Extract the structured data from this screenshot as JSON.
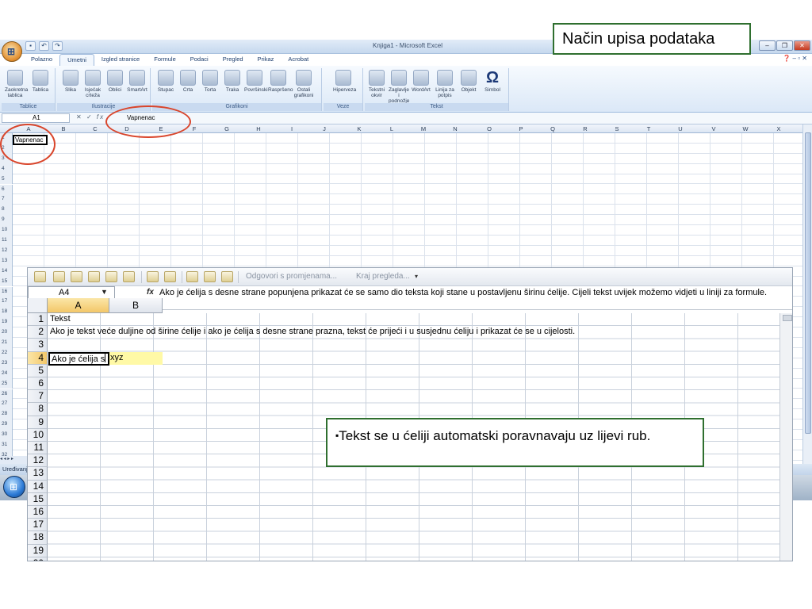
{
  "annotation": {
    "title": "Način upisa podataka",
    "note": "Tekst se u ćeliji automatski poravnavaju uz lijevi rub."
  },
  "excel2007": {
    "window_title": "Knjiga1 - Microsoft Excel",
    "tabs": [
      "Polazno",
      "Umetni",
      "Izgled stranice",
      "Formule",
      "Podaci",
      "Pregled",
      "Prikaz",
      "Acrobat"
    ],
    "active_tab": "Umetni",
    "ribbon_groups": [
      {
        "label": "Tablice",
        "buttons": [
          "Zaokretna tablica",
          "Tablica"
        ]
      },
      {
        "label": "Ilustracije",
        "buttons": [
          "Slika",
          "Isječak crteža",
          "Oblici",
          "SmartArt"
        ]
      },
      {
        "label": "Grafikoni",
        "buttons": [
          "Stupac",
          "Crta",
          "Torta",
          "Traka",
          "Površinski",
          "Raspršeno",
          "Ostali grafikoni"
        ]
      },
      {
        "label": "Veze",
        "buttons": [
          "Hiperveza"
        ]
      },
      {
        "label": "Tekst",
        "buttons": [
          "Tekstni okvir",
          "Zaglavlje i podnožje",
          "WordArt",
          "Linija za potpis",
          "Objekt",
          "Simbol"
        ]
      }
    ],
    "name_box": "A1",
    "formula_value": "Vapnenac",
    "columns": [
      "A",
      "B",
      "C",
      "D",
      "E",
      "F",
      "G",
      "H",
      "I",
      "J",
      "K",
      "L",
      "M",
      "N",
      "O",
      "P",
      "Q",
      "R",
      "S",
      "T",
      "U",
      "V",
      "W",
      "X"
    ],
    "rows": [
      "1",
      "2",
      "3",
      "4",
      "5",
      "6",
      "7",
      "8",
      "9",
      "10",
      "11",
      "12",
      "13",
      "14",
      "15",
      "16",
      "17",
      "18",
      "19",
      "20",
      "21",
      "22",
      "23",
      "24",
      "25",
      "26",
      "27",
      "28",
      "29",
      "30",
      "31",
      "32"
    ],
    "cell_a1": "Vapnenac",
    "status": "Uređivanje"
  },
  "excel2003": {
    "toolbar_review": "Odgovori s promjenama...",
    "toolbar_end": "Kraj pregleda...",
    "name_box": "A4",
    "fx": "fx",
    "formula_text": "Ako je ćelija s desne strane popunjena prikazat će se samo dio teksta koji stane u postavljenu širinu ćelije. Cijeli tekst uvijek možemo vidjeti u liniji za formule.",
    "columns": [
      "A",
      "B"
    ],
    "rows": [
      "1",
      "2",
      "3",
      "4",
      "5",
      "6",
      "7",
      "8",
      "9",
      "10",
      "11",
      "12",
      "13",
      "14",
      "15",
      "16",
      "17",
      "18",
      "19",
      "20"
    ],
    "cells": {
      "a1": "Tekst",
      "a2": "Ako je tekst veće duljine od širine ćelije i ako je ćelija s desne strane prazna, tekst će prijeći i u susjednu ćeliju i prikazat će se u cijelosti.",
      "a4": "Ako je ćelija s",
      "b4": "xyz"
    }
  }
}
